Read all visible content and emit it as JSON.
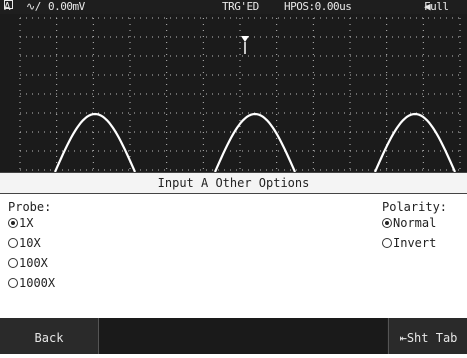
{
  "status": {
    "channel": "A",
    "coupling": "∿/",
    "trigger_level": "0.00mV",
    "trigger_state": "TRG'ED",
    "h_position": "HPOS:0.00us",
    "battery": "Full"
  },
  "menu": {
    "title": "Input A Other Options"
  },
  "probe": {
    "label": "Probe:",
    "options": [
      "1X",
      "10X",
      "100X",
      "1000X"
    ],
    "selected": "1X"
  },
  "polarity": {
    "label": "Polarity:",
    "options": [
      "Normal",
      "Invert"
    ],
    "selected": "Normal"
  },
  "softkeys": {
    "back": "Back",
    "shift_tab": "Sht Tab"
  },
  "colors": {
    "screen_bg": "#1b1b1b",
    "grid": "#bdbdbd",
    "trace": "#ffffff"
  }
}
